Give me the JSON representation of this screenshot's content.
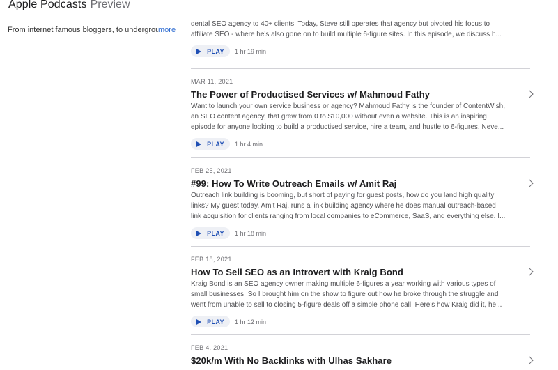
{
  "header": {
    "app_name": "Apple Podcasts",
    "suffix": "Preview"
  },
  "sidebar": {
    "description": "From internet famous bloggers, to underground",
    "more_label": "more"
  },
  "play_label": "PLAY",
  "episodes": [
    {
      "date": "",
      "title": "",
      "summary": [
        "dental SEO agency to 40+ clients. Today, Steve still operates that agency but pivoted his focus to",
        "affiliate SEO - where he's also gone on to build multiple 6-figure sites. In this episode, we discuss h..."
      ],
      "duration": "1 hr 19 min"
    },
    {
      "date": "MAR 11, 2021",
      "title": "The Power of Productised Services w/ Mahmoud Fathy",
      "summary": [
        "Want to launch your own service business or agency? Mahmoud Fathy is the founder of ContentWish,",
        "an SEO content agency, that grew from 0 to $10,000 without even a website. This is an inspiring",
        "episode for anyone looking to build a productised service, hire a team, and hustle to 6-figures. Neve..."
      ],
      "duration": "1 hr 4 min"
    },
    {
      "date": "FEB 25, 2021",
      "title": "#99: How To Write Outreach Emails w/ Amit Raj",
      "summary": [
        "Outreach link building is booming, but short of paying for guest posts, how do you land high quality",
        "links? My guest today, Amit Raj, runs a link building agency where he does manual outreach-based",
        "link acquisition for clients ranging from local companies to eCommerce, SaaS, and everything else. I..."
      ],
      "duration": "1 hr 18 min"
    },
    {
      "date": "FEB 18, 2021",
      "title": "How To Sell SEO as an Introvert with Kraig Bond",
      "summary": [
        "Kraig Bond is an SEO agency owner making multiple 6-figures a year working with various types of",
        "small businesses. So I brought him on the show to figure out how he broke through the struggle and",
        "went from unable to sell to closing 5-figure deals off a simple phone call. Here's how Kraig did it, he..."
      ],
      "duration": "1 hr 12 min"
    },
    {
      "date": "FEB 4, 2021",
      "title": "$20k/m With No Backlinks with Ulhas Sakhare",
      "summary": [],
      "duration": ""
    }
  ]
}
